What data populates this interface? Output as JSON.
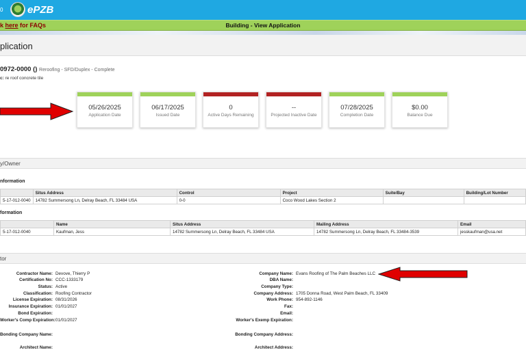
{
  "header": {
    "logo_text": "ePZB",
    "left_edge_glyph": "0"
  },
  "nav": {
    "faq_prefix": "k ",
    "faq_link": "here",
    "faq_suffix": " for FAQs",
    "view_title": "Building - View Application"
  },
  "page": {
    "title": "plication"
  },
  "permit": {
    "number": "0972-0000 ()",
    "type": "Reroofing - SFD/Duplex - Complete",
    "desc_label": "c:",
    "desc_value": "re roof concrete tile"
  },
  "cards": [
    {
      "value": "05/26/2025",
      "label": "Application Date",
      "color": "#9fd25a"
    },
    {
      "value": "06/17/2025",
      "label": "Issued Date",
      "color": "#9fd25a"
    },
    {
      "value": "0",
      "label": "Active Days Remaining",
      "color": "#b22222"
    },
    {
      "value": "--",
      "label": "Projected Inactive Date",
      "color": "#b22222"
    },
    {
      "value": "07/28/2025",
      "label": "Completion Date",
      "color": "#9fd25a"
    },
    {
      "value": "$0.00",
      "label": "Balance Due",
      "color": "#9fd25a"
    }
  ],
  "property_section": {
    "title": "y/Owner",
    "parcel_head": "nformation",
    "parcel_columns": [
      "",
      "Situs Address",
      "Control",
      "Project",
      "Suite/Bay",
      "Building/Lot Number"
    ],
    "parcel_row": [
      "5-17-012-0040",
      "14782 Summersong Ln, Delray Beach, FL 33484 USA",
      "0-0",
      "Coco Wood Lakes Section 2",
      "",
      ""
    ],
    "owner_head": "formation",
    "owner_columns": [
      "",
      "Name",
      "Situs Address",
      "Mailing Address",
      "Email"
    ],
    "owner_row": [
      "5-17-012-0040",
      "Kaufman, Jess",
      "14782 Summersong Ln, Delray Beach, FL 33484 USA",
      "14782 Summersong Ln, Delray Beach, FL 33484-3539",
      "jesskaufman@usa.net"
    ]
  },
  "contractor_section": {
    "title": "tor",
    "left": [
      {
        "label": "Contractor Name:",
        "value": "Devove, Thierry P"
      },
      {
        "label": "Certification No:",
        "value": "CCC-1333179"
      },
      {
        "label": "Status:",
        "value": "Active"
      },
      {
        "label": "Classification:",
        "value": "Roofing Contractor"
      },
      {
        "label": "License Expiration:",
        "value": "08/31/2026"
      },
      {
        "label": "Insurance Expiration:",
        "value": "01/01/2027"
      },
      {
        "label": "Bond Expiration:",
        "value": ""
      },
      {
        "label": "Worker's Comp Expiration:",
        "value": "01/01/2027"
      }
    ],
    "right": [
      {
        "label": "Company Name:",
        "value": "Evans Roofing of The Palm Beaches LLC"
      },
      {
        "label": "DBA Name:",
        "value": ""
      },
      {
        "label": "Company Type:",
        "value": ""
      },
      {
        "label": "Company Address:",
        "value": "1705 Donna Road, West Palm Beach, FL 33409"
      },
      {
        "label": "Work Phone:",
        "value": "954-892-1146"
      },
      {
        "label": "Fax:",
        "value": ""
      },
      {
        "label": "Email:",
        "value": ""
      },
      {
        "label": "Worker's Exemp Expiration:",
        "value": ""
      }
    ],
    "bonding_company_name_label": "Bonding Company Name:",
    "bonding_company_address_label": "Bonding Company Address:",
    "architect_name_label": "Architect Name:",
    "architect_address_label": "Architect Address:"
  },
  "colors": {
    "header_blue": "#1fa8e2",
    "nav_green": "#9fd25a",
    "arrow_red": "#e00000"
  }
}
